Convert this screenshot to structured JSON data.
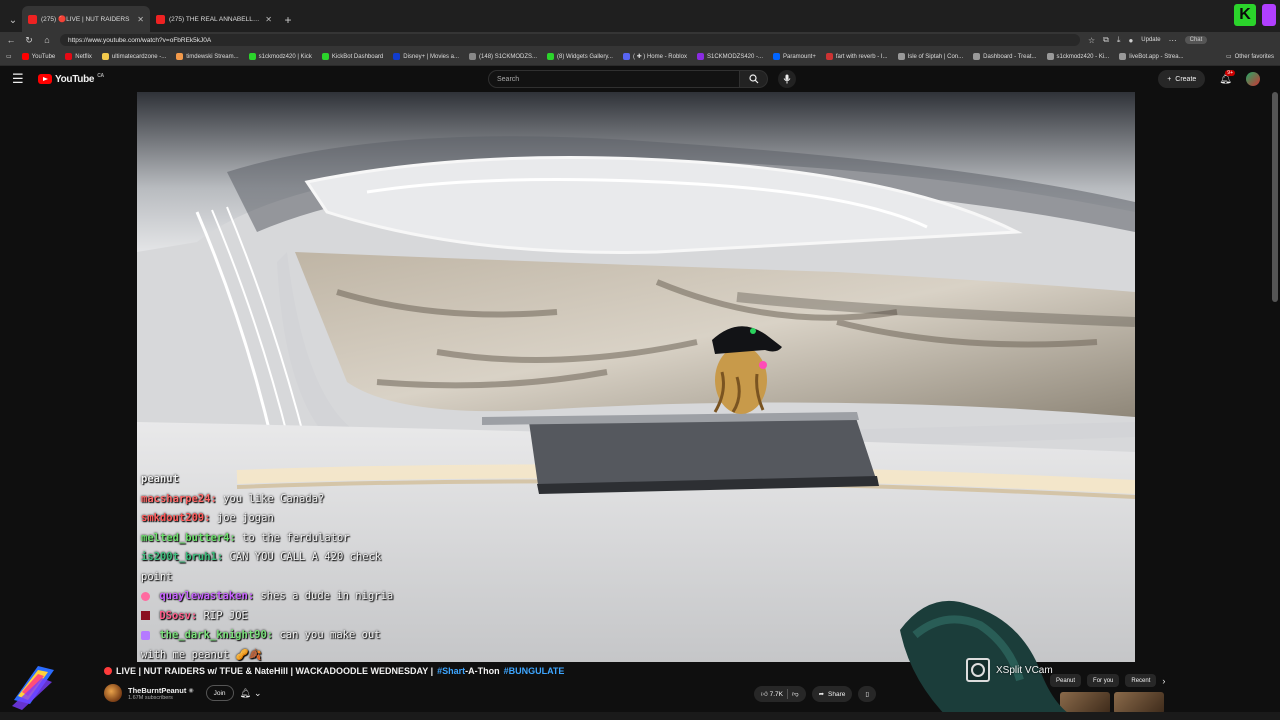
{
  "tabs": [
    {
      "label": "(275) 🔴LIVE | NUT RAIDERS",
      "active": true
    },
    {
      "label": "(275) THE REAL ANNABELLE ATTA",
      "active": false
    }
  ],
  "address_bar": {
    "url": "https://www.youtube.com/watch?v=oFbREk5kJ0A"
  },
  "toolbar": {
    "update_label": "Update",
    "chat_label": "Chat"
  },
  "bookmarks": [
    "YouTube",
    "Netflix",
    "ultimatecardzone -...",
    "timdewski Stream...",
    "s1ckmodz420 | Kick",
    "KickBot Dashboard",
    "Disney+ | Movies a...",
    "(148) S1CKMODZS...",
    "(8) Widgets Gallery...",
    "( ✚ ) Home - Roblox",
    "S1CKMODZS420 -...",
    "Paramount+",
    "fart with reverb - I...",
    "Isle of Siptah | Con...",
    "Dashboard - Treat...",
    "s1ckmodz420 - Ki...",
    "liveBot.app - Strea..."
  ],
  "bookmarks_other": "Other favorites",
  "youtube": {
    "logo_text": "YouTube",
    "country": "CA",
    "search_placeholder": "Search",
    "create_label": "Create",
    "notif_count": "9+"
  },
  "chat_overlay": [
    {
      "user": "peanut",
      "message": "",
      "color": "#f1f1f1"
    },
    {
      "user": "macsharpe24:",
      "message": "you like Canada?",
      "color": "#ff6a6a"
    },
    {
      "user": "smkdout209:",
      "message": "joe jogan",
      "color": "#ff5b5b"
    },
    {
      "user": "melted_butter4:",
      "message": "to the ferdulator",
      "color": "#6fe06f"
    },
    {
      "user": "is200t_bruh1:",
      "message": "CAN YOU CALL A 420 check",
      "color": "#3fbf7f"
    },
    {
      "user": "",
      "message": "point",
      "color": "#f1f1f1"
    },
    {
      "user": "quaylewastaken:",
      "message": "shes a dude in nigria",
      "color": "#c966ff"
    },
    {
      "user": "DSosv:",
      "message": "RIP JOE",
      "color": "#ff5e8a"
    },
    {
      "user": "the_dark_knight90:",
      "message": "can you make out",
      "color": "#7be07b"
    },
    {
      "user": "",
      "message": "with me peanut",
      "color": "#f1f1f1"
    }
  ],
  "video": {
    "title_main": "LIVE | NUT RAIDERS w/ TFUE & NateHill | WACKADOODLE WEDNESDAY |",
    "hashtag1": "#Shart",
    "title_mid": "-A-Thon",
    "hashtag2": "#BUNGULATE",
    "channel_name": "TheBurntPeanut",
    "subscribers": "1.67M subscribers",
    "join_label": "Join",
    "likes": "7.7K",
    "share_label": "Share"
  },
  "recommendations": {
    "chips": [
      "Peanut",
      "For you",
      "Recent"
    ]
  },
  "xsplit_label": "XSplit VCam",
  "colors": {
    "accent": "#ff0000",
    "link": "#3ea6ff",
    "kick": "#2bd42b"
  }
}
